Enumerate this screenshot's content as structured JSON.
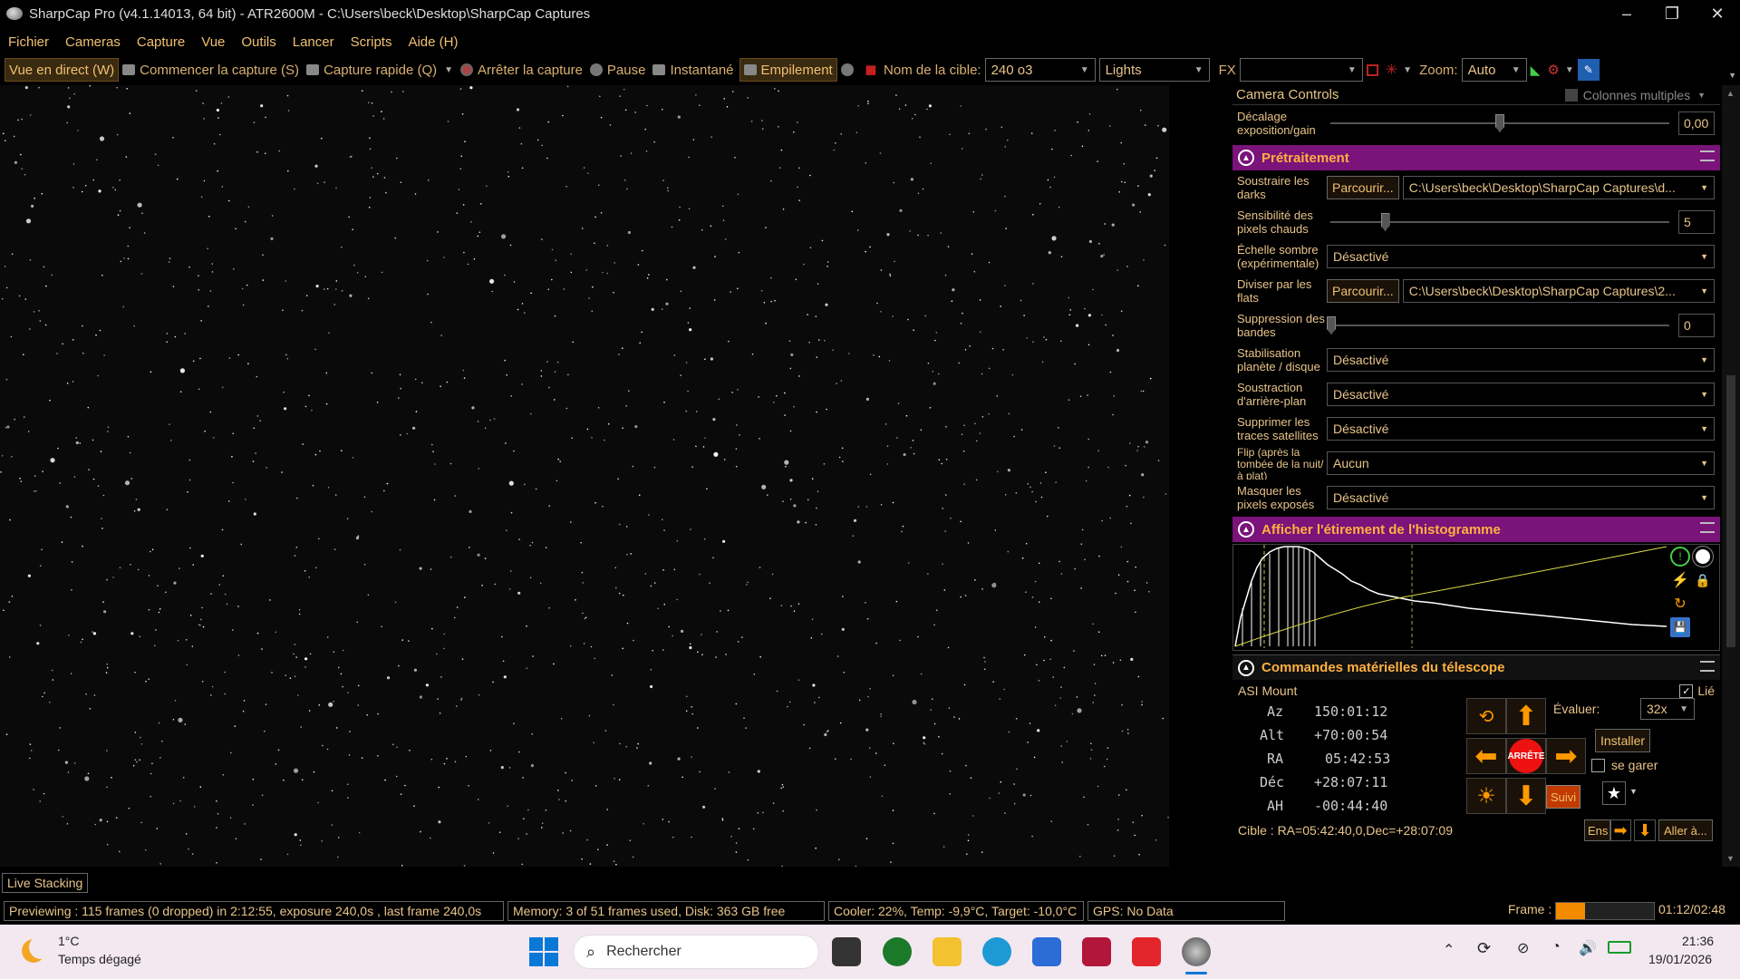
{
  "title": "SharpCap Pro (v4.1.14013, 64 bit) - ATR2600M - C:\\Users\\beck\\Desktop\\SharpCap Captures",
  "menu": [
    "Fichier",
    "Cameras",
    "Capture",
    "Vue",
    "Outils",
    "Lancer",
    "Scripts",
    "Aide (H)"
  ],
  "toolbar": {
    "live": "Vue en direct (W)",
    "start": "Commencer la capture (S)",
    "quick": "Capture rapide (Q)",
    "stop": "Arrêter la capture",
    "pause": "Pause",
    "snapshot": "Instantané",
    "stack": "Empilement",
    "target_label": "Nom de la cible:",
    "target_value": "240 o3",
    "frame_type": "Lights",
    "fx": "FX",
    "fx_value": "",
    "zoom_label": "Zoom:",
    "zoom_value": "Auto"
  },
  "panel": {
    "title": "Camera Controls",
    "multi": "Colonnes multiples",
    "offset": {
      "label": "Décalage exposition/gain",
      "value": "0,00",
      "level": 0.5
    },
    "pre": {
      "title": "Prétraitement",
      "darks": {
        "label": "Soustraire les darks",
        "browse": "Parcourir...",
        "path": "C:\\Users\\beck\\Desktop\\SharpCap Captures\\d..."
      },
      "hot": {
        "label": "Sensibilité des pixels chauds",
        "value": "5",
        "level": 0.16
      },
      "scale": {
        "label": "Échelle sombre (expérimentale)",
        "value": "Désactivé"
      },
      "flats": {
        "label": "Diviser par les flats",
        "browse": "Parcourir...",
        "path": "C:\\Users\\beck\\Desktop\\SharpCap Captures\\2..."
      },
      "banding": {
        "label": "Suppression des bandes",
        "value": "0",
        "level": 0.0
      },
      "stab": {
        "label": "Stabilisation planète / disque",
        "value": "Désactivé"
      },
      "bg": {
        "label": "Soustraction d'arrière-plan",
        "value": "Désactivé"
      },
      "sat": {
        "label": "Supprimer les traces satellites",
        "value": "Désactivé"
      },
      "flip": {
        "label": "Flip (après la tombée de la nuit/à plat)",
        "value": "Aucun"
      },
      "mask": {
        "label": "Masquer les pixels exposés",
        "value": "Désactivé"
      }
    },
    "hist": {
      "title": "Afficher l'étirement de l'histogramme"
    },
    "tel": {
      "title": "Commandes matérielles du télescope",
      "mount": "ASI Mount",
      "linked": "Lié",
      "az_l": "Az",
      "az": "150:01:12",
      "alt_l": "Alt",
      "alt": "+70:00:54",
      "ra_l": "RA",
      "ra": "05:42:53",
      "dec_l": "Déc",
      "dec": "+28:07:11",
      "ah_l": "AH",
      "ah": "-00:44:40",
      "eval": "Évaluer:",
      "rate": "32x",
      "install": "Installer",
      "park": "se garer",
      "stop": "ARRÊTE",
      "track": "Suivi",
      "target": "Cible : RA=05:42:40,0,Dec=+28:07:09",
      "ens": "Ens",
      "goto": "Aller à..."
    }
  },
  "status": {
    "tab": "Live Stacking",
    "preview": "Previewing : 115 frames (0 dropped) in 2:12:55, exposure 240,0s , last frame 240,0s",
    "memory": "Memory: 3 of 51 frames used, Disk: 363 GB free",
    "cooler": "Cooler: 22%, Temp: -9,9°C, Target: -10,0°C",
    "gps": "GPS: No Data",
    "frame_label": "Frame :",
    "frame_time": "01:12/02:48",
    "frame_progress": 0.3
  },
  "taskbar": {
    "temp": "1°C",
    "weather": "Temps dégagé",
    "search": "Rechercher",
    "time": "21:36",
    "date": "19/01/2026"
  }
}
